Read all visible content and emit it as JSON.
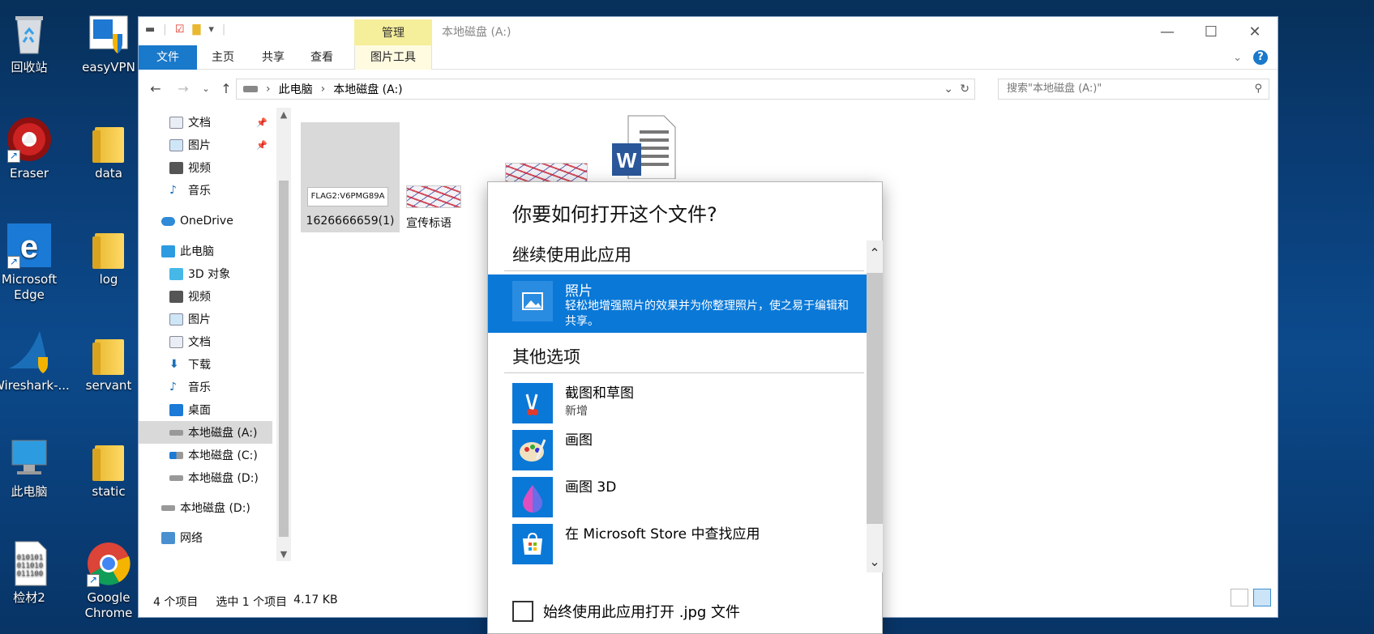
{
  "desktop": {
    "icons": [
      {
        "label": "回收站",
        "icon": "recycle-bin-icon"
      },
      {
        "label": "easyVPN",
        "icon": "shield-app-icon"
      },
      {
        "label": "Eraser",
        "icon": "eraser-app-icon"
      },
      {
        "label": "data",
        "icon": "folder-icon"
      },
      {
        "label": "Microsoft Edge",
        "icon": "edge-icon"
      },
      {
        "label": "log",
        "icon": "folder-icon"
      },
      {
        "label": "Wireshark-...",
        "icon": "wireshark-icon"
      },
      {
        "label": "servant",
        "icon": "folder-icon"
      },
      {
        "label": "此电脑",
        "icon": "computer-icon"
      },
      {
        "label": "static",
        "icon": "folder-icon"
      },
      {
        "label": "检材2",
        "icon": "binary-file-icon"
      },
      {
        "label": "Google Chrome",
        "icon": "chrome-icon"
      }
    ]
  },
  "window": {
    "title": "本地磁盘 (A:)",
    "manage_tab": "管理",
    "ribbon_tabs": [
      "文件",
      "主页",
      "共享",
      "查看",
      "图片工具"
    ],
    "controls": {
      "minimize": "—",
      "maximize": "☐",
      "close": "✕"
    },
    "address": {
      "segments": [
        "此电脑",
        "本地磁盘 (A:)"
      ]
    },
    "search_placeholder": "搜索\"本地磁盘 (A:)\"",
    "nav": [
      {
        "label": "文档",
        "pinned": true
      },
      {
        "label": "图片",
        "pinned": true
      },
      {
        "label": "视频"
      },
      {
        "label": "音乐"
      },
      {
        "label": "OneDrive"
      },
      {
        "label": "此电脑"
      },
      {
        "label": "3D 对象"
      },
      {
        "label": "视频"
      },
      {
        "label": "图片"
      },
      {
        "label": "文档"
      },
      {
        "label": "下载"
      },
      {
        "label": "音乐"
      },
      {
        "label": "桌面"
      },
      {
        "label": "本地磁盘 (A:)",
        "selected": true
      },
      {
        "label": "本地磁盘 (C:)"
      },
      {
        "label": "本地磁盘 (D:)"
      },
      {
        "label": "本地磁盘 (D:)"
      },
      {
        "label": "网络"
      }
    ],
    "files": [
      {
        "name": "1626666659(1)",
        "thumb_text": "FLAG2:V6PMG89A",
        "selected": true
      },
      {
        "name": "宣传标语"
      },
      {
        "name": ""
      },
      {
        "name": ""
      }
    ],
    "status": {
      "count": "4 个项目",
      "selection": "选中 1 个项目",
      "size": "4.17 KB"
    }
  },
  "dialog": {
    "title": "你要如何打开这个文件?",
    "keep_using": "继续使用此应用",
    "highlight_app": {
      "name": "照片",
      "desc": "轻松地增强照片的效果并为你整理照片，使之易于编辑和共享。"
    },
    "other_options": "其他选项",
    "apps": [
      {
        "name": "截图和草图",
        "sub": "新增"
      },
      {
        "name": "画图",
        "sub": ""
      },
      {
        "name": "画图 3D",
        "sub": ""
      },
      {
        "name": "在 Microsoft Store 中查找应用",
        "sub": ""
      }
    ],
    "checkbox_label": "始终使用此应用打开 .jpg 文件"
  }
}
